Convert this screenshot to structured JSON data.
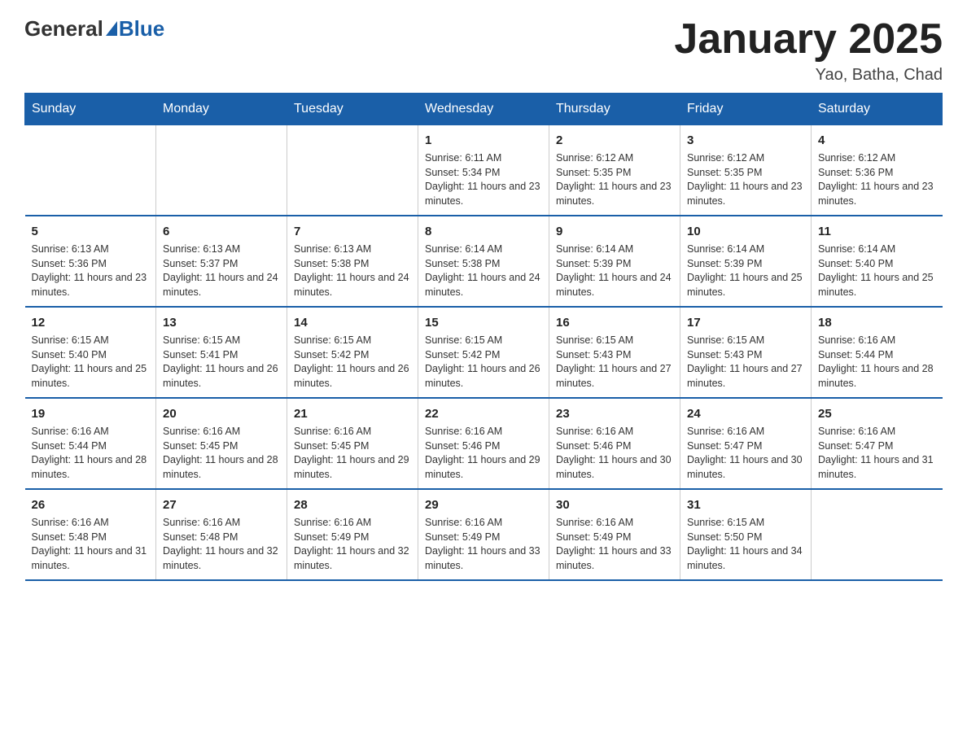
{
  "logo": {
    "general": "General",
    "blue": "Blue"
  },
  "title": "January 2025",
  "subtitle": "Yao, Batha, Chad",
  "days_of_week": [
    "Sunday",
    "Monday",
    "Tuesday",
    "Wednesday",
    "Thursday",
    "Friday",
    "Saturday"
  ],
  "weeks": [
    [
      {
        "day": "",
        "info": ""
      },
      {
        "day": "",
        "info": ""
      },
      {
        "day": "",
        "info": ""
      },
      {
        "day": "1",
        "info": "Sunrise: 6:11 AM\nSunset: 5:34 PM\nDaylight: 11 hours and 23 minutes."
      },
      {
        "day": "2",
        "info": "Sunrise: 6:12 AM\nSunset: 5:35 PM\nDaylight: 11 hours and 23 minutes."
      },
      {
        "day": "3",
        "info": "Sunrise: 6:12 AM\nSunset: 5:35 PM\nDaylight: 11 hours and 23 minutes."
      },
      {
        "day": "4",
        "info": "Sunrise: 6:12 AM\nSunset: 5:36 PM\nDaylight: 11 hours and 23 minutes."
      }
    ],
    [
      {
        "day": "5",
        "info": "Sunrise: 6:13 AM\nSunset: 5:36 PM\nDaylight: 11 hours and 23 minutes."
      },
      {
        "day": "6",
        "info": "Sunrise: 6:13 AM\nSunset: 5:37 PM\nDaylight: 11 hours and 24 minutes."
      },
      {
        "day": "7",
        "info": "Sunrise: 6:13 AM\nSunset: 5:38 PM\nDaylight: 11 hours and 24 minutes."
      },
      {
        "day": "8",
        "info": "Sunrise: 6:14 AM\nSunset: 5:38 PM\nDaylight: 11 hours and 24 minutes."
      },
      {
        "day": "9",
        "info": "Sunrise: 6:14 AM\nSunset: 5:39 PM\nDaylight: 11 hours and 24 minutes."
      },
      {
        "day": "10",
        "info": "Sunrise: 6:14 AM\nSunset: 5:39 PM\nDaylight: 11 hours and 25 minutes."
      },
      {
        "day": "11",
        "info": "Sunrise: 6:14 AM\nSunset: 5:40 PM\nDaylight: 11 hours and 25 minutes."
      }
    ],
    [
      {
        "day": "12",
        "info": "Sunrise: 6:15 AM\nSunset: 5:40 PM\nDaylight: 11 hours and 25 minutes."
      },
      {
        "day": "13",
        "info": "Sunrise: 6:15 AM\nSunset: 5:41 PM\nDaylight: 11 hours and 26 minutes."
      },
      {
        "day": "14",
        "info": "Sunrise: 6:15 AM\nSunset: 5:42 PM\nDaylight: 11 hours and 26 minutes."
      },
      {
        "day": "15",
        "info": "Sunrise: 6:15 AM\nSunset: 5:42 PM\nDaylight: 11 hours and 26 minutes."
      },
      {
        "day": "16",
        "info": "Sunrise: 6:15 AM\nSunset: 5:43 PM\nDaylight: 11 hours and 27 minutes."
      },
      {
        "day": "17",
        "info": "Sunrise: 6:15 AM\nSunset: 5:43 PM\nDaylight: 11 hours and 27 minutes."
      },
      {
        "day": "18",
        "info": "Sunrise: 6:16 AM\nSunset: 5:44 PM\nDaylight: 11 hours and 28 minutes."
      }
    ],
    [
      {
        "day": "19",
        "info": "Sunrise: 6:16 AM\nSunset: 5:44 PM\nDaylight: 11 hours and 28 minutes."
      },
      {
        "day": "20",
        "info": "Sunrise: 6:16 AM\nSunset: 5:45 PM\nDaylight: 11 hours and 28 minutes."
      },
      {
        "day": "21",
        "info": "Sunrise: 6:16 AM\nSunset: 5:45 PM\nDaylight: 11 hours and 29 minutes."
      },
      {
        "day": "22",
        "info": "Sunrise: 6:16 AM\nSunset: 5:46 PM\nDaylight: 11 hours and 29 minutes."
      },
      {
        "day": "23",
        "info": "Sunrise: 6:16 AM\nSunset: 5:46 PM\nDaylight: 11 hours and 30 minutes."
      },
      {
        "day": "24",
        "info": "Sunrise: 6:16 AM\nSunset: 5:47 PM\nDaylight: 11 hours and 30 minutes."
      },
      {
        "day": "25",
        "info": "Sunrise: 6:16 AM\nSunset: 5:47 PM\nDaylight: 11 hours and 31 minutes."
      }
    ],
    [
      {
        "day": "26",
        "info": "Sunrise: 6:16 AM\nSunset: 5:48 PM\nDaylight: 11 hours and 31 minutes."
      },
      {
        "day": "27",
        "info": "Sunrise: 6:16 AM\nSunset: 5:48 PM\nDaylight: 11 hours and 32 minutes."
      },
      {
        "day": "28",
        "info": "Sunrise: 6:16 AM\nSunset: 5:49 PM\nDaylight: 11 hours and 32 minutes."
      },
      {
        "day": "29",
        "info": "Sunrise: 6:16 AM\nSunset: 5:49 PM\nDaylight: 11 hours and 33 minutes."
      },
      {
        "day": "30",
        "info": "Sunrise: 6:16 AM\nSunset: 5:49 PM\nDaylight: 11 hours and 33 minutes."
      },
      {
        "day": "31",
        "info": "Sunrise: 6:15 AM\nSunset: 5:50 PM\nDaylight: 11 hours and 34 minutes."
      },
      {
        "day": "",
        "info": ""
      }
    ]
  ]
}
